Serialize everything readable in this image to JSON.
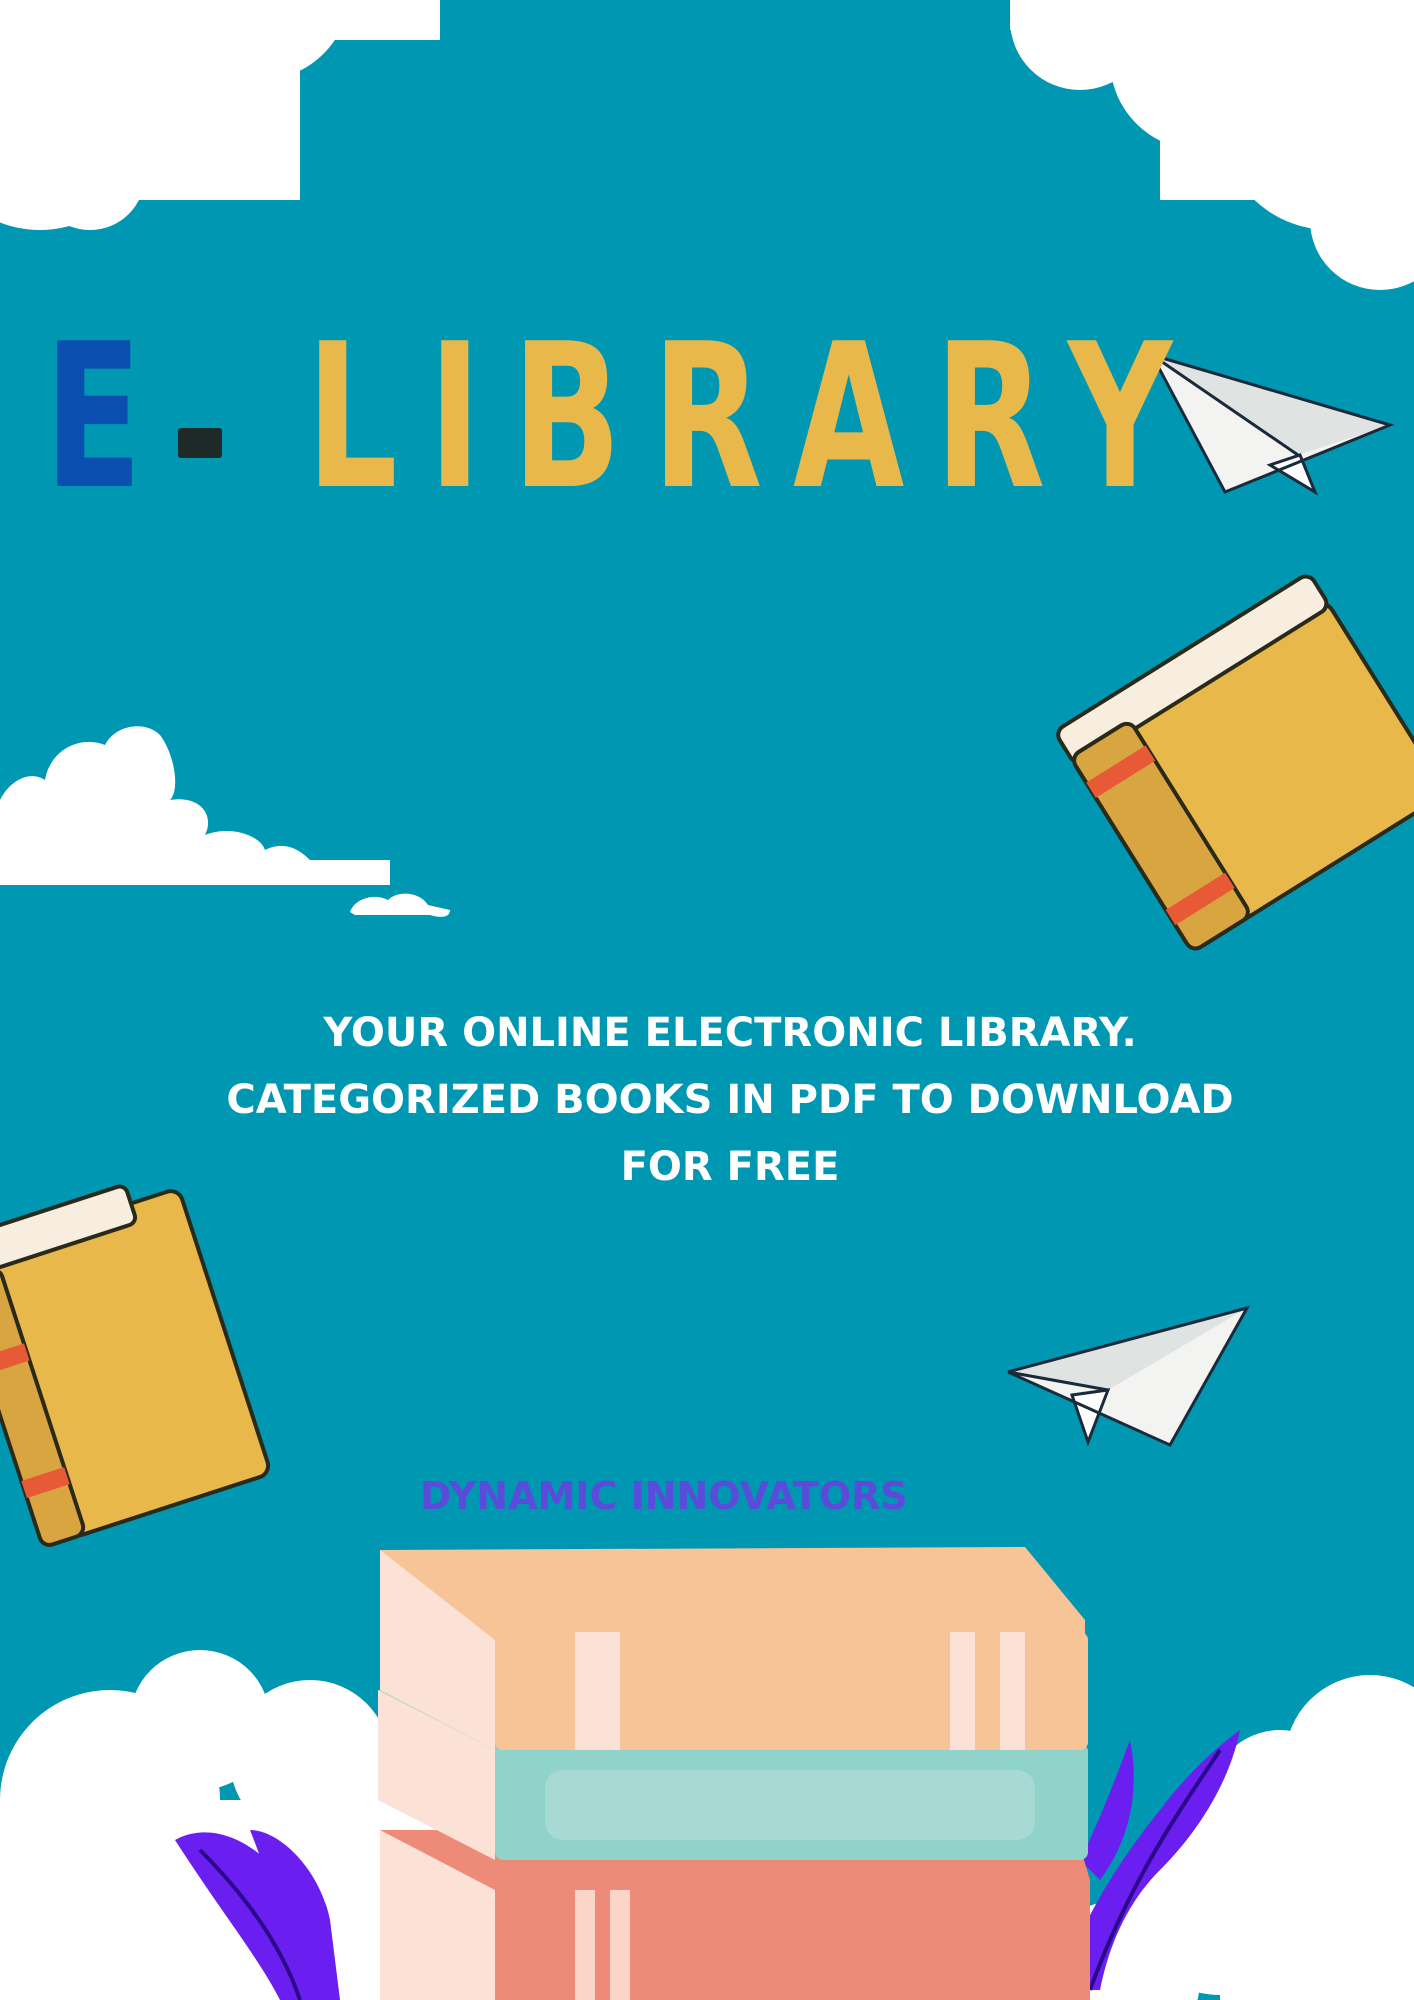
{
  "title": {
    "prefix": "E",
    "main": "LIBRARY"
  },
  "tagline": {
    "line1": "YOUR ONLINE ELECTRONIC LIBRARY.",
    "line2": "CATEGORIZED BOOKS IN PDF TO DOWNLOAD",
    "line3": "FOR FREE"
  },
  "brand": "DYNAMIC INNOVATORS",
  "icons": [
    "cloud-icon",
    "paper-plane-icon",
    "book-icon",
    "book-stack-icon",
    "leaf-icon"
  ],
  "colors": {
    "background": "#0097b2",
    "title_prefix": "#0a4fb0",
    "title_main": "#e8b84a",
    "tagline": "#ffffff",
    "brand": "#5b4bdb",
    "cloud": "#ffffff",
    "book_yellow": "#e8b84a",
    "book_orange": "#f7c498",
    "book_teal": "#8fd3cb",
    "book_red": "#ee8a78",
    "leaf_purple": "#6a1ef0"
  }
}
